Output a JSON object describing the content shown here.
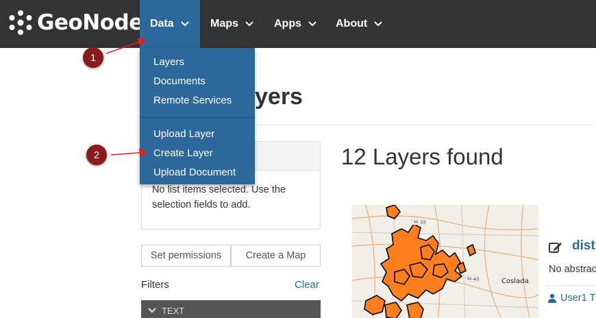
{
  "brand": {
    "name": "GeoNode",
    "icon": "geonode-logo-icon"
  },
  "nav": {
    "data": "Data",
    "maps": "Maps",
    "apps": "Apps",
    "about": "About"
  },
  "dropdown": {
    "items": [
      "Layers",
      "Documents",
      "Remote Services",
      "Upload Layer",
      "Create Layer",
      "Upload Document"
    ]
  },
  "page": {
    "title_visible": "yers",
    "results": "12 Layers found"
  },
  "selection": {
    "empty_text": "No list items selected. Use the selection fields to add."
  },
  "buttons": {
    "set_permissions": "Set permissions",
    "create_map": "Create a Map"
  },
  "filters": {
    "label": "Filters",
    "clear": "Clear",
    "text_section": "TEXT"
  },
  "result_item": {
    "title": "distr",
    "abstract": "No abstrac",
    "owner": "User1 T",
    "map_labels": [
      "M-30",
      "M-40",
      "Coslada"
    ]
  },
  "annotations": {
    "step1": "1",
    "step2": "2"
  },
  "colors": {
    "navbar": "#333333",
    "accent": "#2c689c",
    "marker": "#8b1a1a",
    "polygon": "#ff7f1e"
  }
}
